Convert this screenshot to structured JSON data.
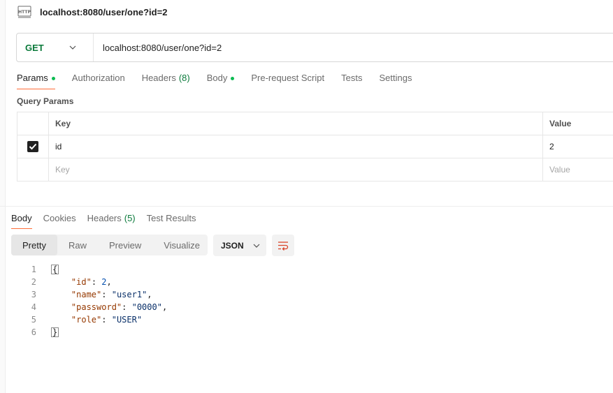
{
  "header": {
    "badge": "HTTP",
    "title": "localhost:8080/user/one?id=2"
  },
  "url_bar": {
    "method": "GET",
    "url": "localhost:8080/user/one?id=2"
  },
  "request_tabs": [
    {
      "label": "Params",
      "dot": true,
      "active": true
    },
    {
      "label": "Authorization"
    },
    {
      "label": "Headers",
      "count": "(8)"
    },
    {
      "label": "Body",
      "dot": true
    },
    {
      "label": "Pre-request Script"
    },
    {
      "label": "Tests"
    },
    {
      "label": "Settings"
    }
  ],
  "query_params": {
    "title": "Query Params",
    "headers": {
      "key": "Key",
      "value": "Value"
    },
    "rows": [
      {
        "checked": true,
        "key": "id",
        "value": "2"
      }
    ],
    "placeholder": {
      "key": "Key",
      "value": "Value"
    }
  },
  "response_tabs": [
    {
      "label": "Body",
      "active": true
    },
    {
      "label": "Cookies"
    },
    {
      "label": "Headers",
      "count": "(5)"
    },
    {
      "label": "Test Results"
    }
  ],
  "view_modes": [
    "Pretty",
    "Raw",
    "Preview",
    "Visualize"
  ],
  "active_view": "Pretty",
  "format": "JSON",
  "response_body": {
    "lines": [
      "1",
      "2",
      "3",
      "4",
      "5",
      "6"
    ],
    "open_brace": "{",
    "close_brace": "}",
    "fields": [
      {
        "key": "\"id\"",
        "value": "2",
        "type": "num",
        "comma": ","
      },
      {
        "key": "\"name\"",
        "value": "\"user1\"",
        "type": "str",
        "comma": ","
      },
      {
        "key": "\"password\"",
        "value": "\"0000\"",
        "type": "str",
        "comma": ","
      },
      {
        "key": "\"role\"",
        "value": "\"USER\"",
        "type": "str",
        "comma": ""
      }
    ]
  },
  "colors": {
    "accent": "#ff6c37",
    "get_method": "#0b7a3b",
    "status_dot": "#0cbb52"
  }
}
